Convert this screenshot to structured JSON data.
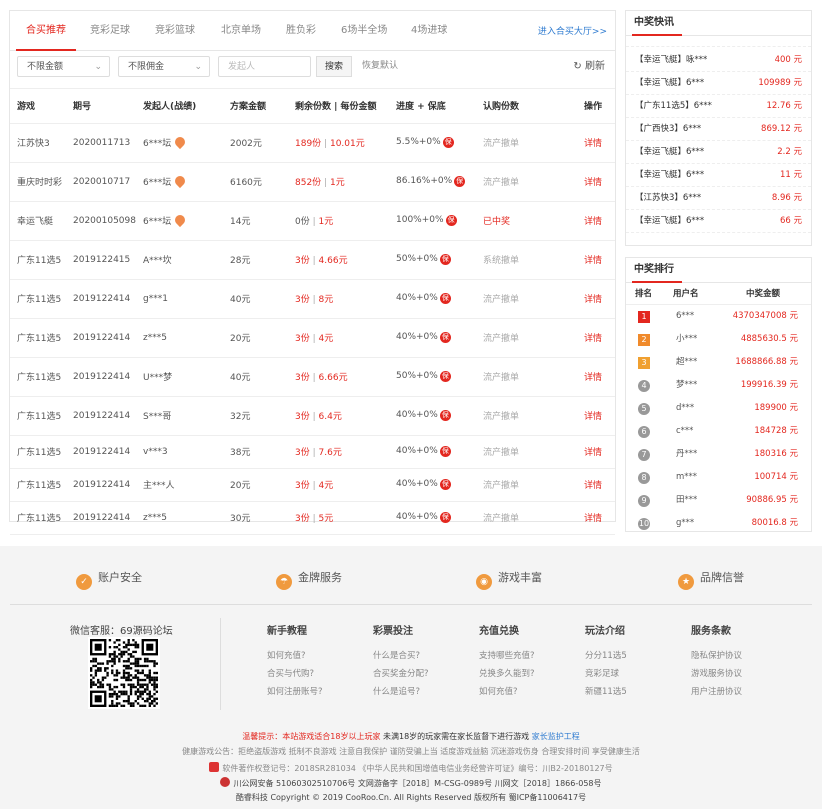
{
  "tabs": [
    "合买推荐",
    "竞彩足球",
    "竞彩篮球",
    "北京单场",
    "胜负彩",
    "6场半全场",
    "4场进球"
  ],
  "enter_link": "进入合买大厅>>",
  "filters": {
    "amount": "不限金额",
    "commission": "不限佣金",
    "initiator_placeholder": "发起人",
    "search": "搜索",
    "reset": "恢复默认",
    "refresh": "刷新"
  },
  "table": {
    "headers": [
      "游戏",
      "期号",
      "发起人(战绩)",
      "方案金额",
      "剩余份数 | 每份金额",
      "进度 + 保底",
      "认购份数",
      "操作"
    ],
    "rows": [
      {
        "game": "江苏快3",
        "issue": "2020011713",
        "user": "6***坛",
        "flame": true,
        "amount": "2002元",
        "remain": "189份",
        "sep": "|",
        "per": "10.01元",
        "progress": "5.5%+0%",
        "bao": "保",
        "status": "流产撤单",
        "status_red": false,
        "op": "详情"
      },
      {
        "game": "重庆时时彩",
        "issue": "2020010717",
        "user": "6***坛",
        "flame": true,
        "amount": "6160元",
        "remain": "852份",
        "sep": "|",
        "per": "1元",
        "progress": "86.16%+0%",
        "bao": "保",
        "status": "流产撤单",
        "status_red": false,
        "op": "详情"
      },
      {
        "game": "幸运飞艇",
        "issue": "20200105098",
        "user": "6***坛",
        "flame": true,
        "amount": "14元",
        "remain": "0份",
        "sep": "|",
        "per": "1元",
        "progress": "100%+0%",
        "bao": "保",
        "status": "已中奖",
        "status_red": true,
        "op": "详情"
      },
      {
        "game": "广东11选5",
        "issue": "2019122415",
        "user": "A***坎",
        "flame": false,
        "amount": "28元",
        "remain": "3份",
        "sep": "|",
        "per": "4.66元",
        "progress": "50%+0%",
        "bao": "保",
        "status": "系统撤单",
        "status_red": false,
        "op": "详情"
      },
      {
        "game": "广东11选5",
        "issue": "2019122414",
        "user": "g***1",
        "flame": false,
        "amount": "40元",
        "remain": "3份",
        "sep": "|",
        "per": "8元",
        "progress": "40%+0%",
        "bao": "保",
        "status": "流产撤单",
        "status_red": false,
        "op": "详情"
      },
      {
        "game": "广东11选5",
        "issue": "2019122414",
        "user": "z***5",
        "flame": false,
        "amount": "20元",
        "remain": "3份",
        "sep": "|",
        "per": "4元",
        "progress": "40%+0%",
        "bao": "保",
        "status": "流产撤单",
        "status_red": false,
        "op": "详情"
      },
      {
        "game": "广东11选5",
        "issue": "2019122414",
        "user": "U***梦",
        "flame": false,
        "amount": "40元",
        "remain": "3份",
        "sep": "|",
        "per": "6.66元",
        "progress": "50%+0%",
        "bao": "保",
        "status": "流产撤单",
        "status_red": false,
        "op": "详情"
      },
      {
        "game": "广东11选5",
        "issue": "2019122414",
        "user": "S***哥",
        "flame": false,
        "amount": "32元",
        "remain": "3份",
        "sep": "|",
        "per": "6.4元",
        "progress": "40%+0%",
        "bao": "保",
        "status": "流产撤单",
        "status_red": false,
        "op": "详情"
      },
      {
        "game": "广东11选5",
        "issue": "2019122414",
        "user": "v***3",
        "flame": false,
        "amount": "38元",
        "remain": "3份",
        "sep": "|",
        "per": "7.6元",
        "progress": "40%+0%",
        "bao": "保",
        "status": "流产撤单",
        "status_red": false,
        "op": "详情"
      },
      {
        "game": "广东11选5",
        "issue": "2019122414",
        "user": "主***人",
        "flame": false,
        "amount": "20元",
        "remain": "3份",
        "sep": "|",
        "per": "4元",
        "progress": "40%+0%",
        "bao": "保",
        "status": "流产撤单",
        "status_red": false,
        "op": "详情"
      },
      {
        "game": "广东11选5",
        "issue": "2019122414",
        "user": "z***5",
        "flame": false,
        "amount": "30元",
        "remain": "3份",
        "sep": "|",
        "per": "5元",
        "progress": "40%+0%",
        "bao": "保",
        "status": "流产撤单",
        "status_red": false,
        "op": "详情"
      }
    ]
  },
  "news": {
    "title": "中奖快讯",
    "items": [
      {
        "text": "【幸运飞艇】咏***",
        "amount": "400 元"
      },
      {
        "text": "【幸运飞艇】6***",
        "amount": "109989 元"
      },
      {
        "text": "【广东11选5】6***",
        "amount": "12.76 元"
      },
      {
        "text": "【广西快3】6***",
        "amount": "869.12 元"
      },
      {
        "text": "【幸运飞艇】6***",
        "amount": "2.2 元"
      },
      {
        "text": "【幸运飞艇】6***",
        "amount": "11 元"
      },
      {
        "text": "【江苏快3】6***",
        "amount": "8.96 元"
      },
      {
        "text": "【幸运飞艇】6***",
        "amount": "66 元"
      }
    ]
  },
  "ranking": {
    "title": "中奖排行",
    "headers": [
      "排名",
      "用户名",
      "中奖金额"
    ],
    "rows": [
      {
        "rank": "1",
        "name": "6***",
        "amount": "4370347008 元",
        "color": "#e3271f"
      },
      {
        "rank": "2",
        "name": "小***",
        "amount": "4885630.5 元",
        "color": "#f08a2b"
      },
      {
        "rank": "3",
        "name": "超***",
        "amount": "1688866.88 元",
        "color": "#f0a030"
      },
      {
        "rank": "4",
        "name": "梦***",
        "amount": "199916.39 元",
        "color": "#999999"
      },
      {
        "rank": "5",
        "name": "d***",
        "amount": "189900 元",
        "color": "#999999"
      },
      {
        "rank": "6",
        "name": "c***",
        "amount": "184728 元",
        "color": "#999999"
      },
      {
        "rank": "7",
        "name": "丹***",
        "amount": "180316 元",
        "color": "#999999"
      },
      {
        "rank": "8",
        "name": "m***",
        "amount": "100714 元",
        "color": "#999999"
      },
      {
        "rank": "9",
        "name": "田***",
        "amount": "90886.95 元",
        "color": "#999999"
      },
      {
        "rank": "10",
        "name": "g***",
        "amount": "80016.8 元",
        "color": "#999999"
      }
    ]
  },
  "features": [
    "账户安全",
    "金牌服务",
    "游戏丰富",
    "品牌信誉"
  ],
  "wechat": "微信客服：69源码论坛",
  "footer_cols": [
    {
      "title": "新手教程",
      "links": [
        "如何充值?",
        "合买与代购?",
        "如何注册账号?"
      ]
    },
    {
      "title": "彩票投注",
      "links": [
        "什么是合买?",
        "合买奖金分配?",
        "什么是追号?"
      ]
    },
    {
      "title": "充值兑换",
      "links": [
        "支持哪些充值?",
        "兑换多久能到?",
        "如何充值?"
      ]
    },
    {
      "title": "玩法介绍",
      "links": [
        "分分11选5",
        "竞彩足球",
        "新疆11选5"
      ]
    },
    {
      "title": "服务条款",
      "links": [
        "隐私保护协议",
        "游戏服务协议",
        "用户注册协议"
      ]
    }
  ],
  "bottom": {
    "warn_label": "温馨提示：",
    "warn_red": "本站游戏适合18岁以上玩家",
    "warn_black": "未满18岁的玩家需在家长监督下进行游戏",
    "warn_link": "家长监护工程",
    "health": "健康游戏公告：拒绝盗版游戏 抵制不良游戏 注意自我保护 谨防受骗上当 适度游戏益脑 沉迷游戏伤身 合理安排时间 享受健康生活",
    "line3": "软件著作权登记号：2018SR281034  《中华人民共和国增值电信业务经营许可证》编号：川B2-20180127号",
    "line4": "川公网安备 51060302510706号    文网游备字［2018］M-CSG-0989号  川网文［2018］1866-058号",
    "line5": "酷睿科技  Copyright © 2019 CooRoo.Cn. All Rights Reserved 版权所有   蜀ICP备11006417号"
  }
}
